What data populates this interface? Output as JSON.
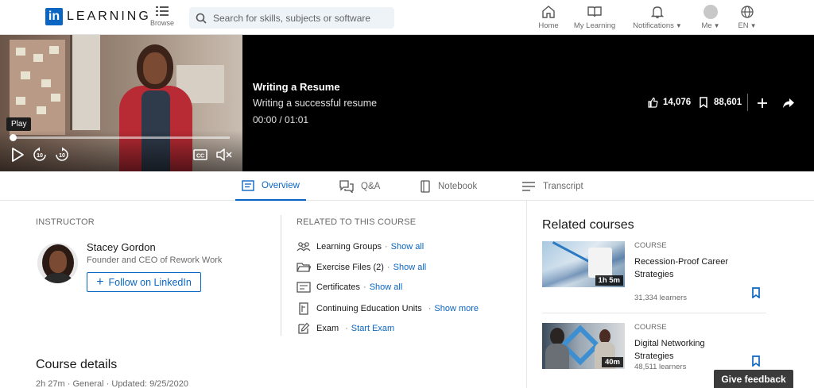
{
  "nav": {
    "logo_in": "in",
    "logo_text": "LEARNING",
    "browse_label": "Browse",
    "search_placeholder": "Search for skills, subjects or software",
    "home_label": "Home",
    "my_learning_label": "My Learning",
    "notifications_label": "Notifications",
    "me_label": "Me",
    "language_label": "EN"
  },
  "player": {
    "tooltip": "Play",
    "progress": 0.0
  },
  "video": {
    "title": "Writing a Resume",
    "subtitle": "Writing a successful resume",
    "time": "00:00 / 01:01",
    "likes": "14,076",
    "saves": "88,601"
  },
  "tabs": [
    {
      "label": "Overview",
      "icon": "overview-icon"
    },
    {
      "label": "Q&A",
      "icon": "qa-icon"
    },
    {
      "label": "Notebook",
      "icon": "notebook-icon"
    },
    {
      "label": "Transcript",
      "icon": "transcript-icon"
    }
  ],
  "instructor": {
    "section_label": "INSTRUCTOR",
    "name": "Stacey Gordon",
    "title": "Founder and CEO of Rework Work",
    "follow_label": "Follow on LinkedIn"
  },
  "related": {
    "section_label": "RELATED TO THIS COURSE",
    "items": [
      {
        "label": "Learning Groups",
        "sep": "·",
        "link": "Show all",
        "icon": "groups-icon"
      },
      {
        "label": "Exercise Files (2)",
        "sep": "·",
        "link": "Show all",
        "icon": "folder-icon"
      },
      {
        "label": "Certificates",
        "sep": "·",
        "link": "Show all",
        "icon": "certificate-icon"
      },
      {
        "label": "Continuing Education Units",
        "sep": "·",
        "link": "Show more",
        "icon": "ceu-icon"
      },
      {
        "label": "Exam",
        "sep": "·",
        "link": "Start Exam",
        "icon": "exam-icon"
      }
    ]
  },
  "course_details": {
    "title": "Course details",
    "meta": "2h 27m  ·  General  ·  Updated: 9/25/2020"
  },
  "related_courses": {
    "heading": "Related courses",
    "cards": [
      {
        "kicker": "COURSE",
        "title": "Recession-Proof Career Strategies",
        "learners": "31,334 learners",
        "duration": "1h 5m"
      },
      {
        "kicker": "COURSE",
        "title": "Digital Networking Strategies",
        "learners": "48,511 learners",
        "duration": "40m"
      }
    ]
  },
  "feedback_label": "Give feedback",
  "colors": {
    "brand": "#0a66c2",
    "video_bg": "#000000"
  }
}
